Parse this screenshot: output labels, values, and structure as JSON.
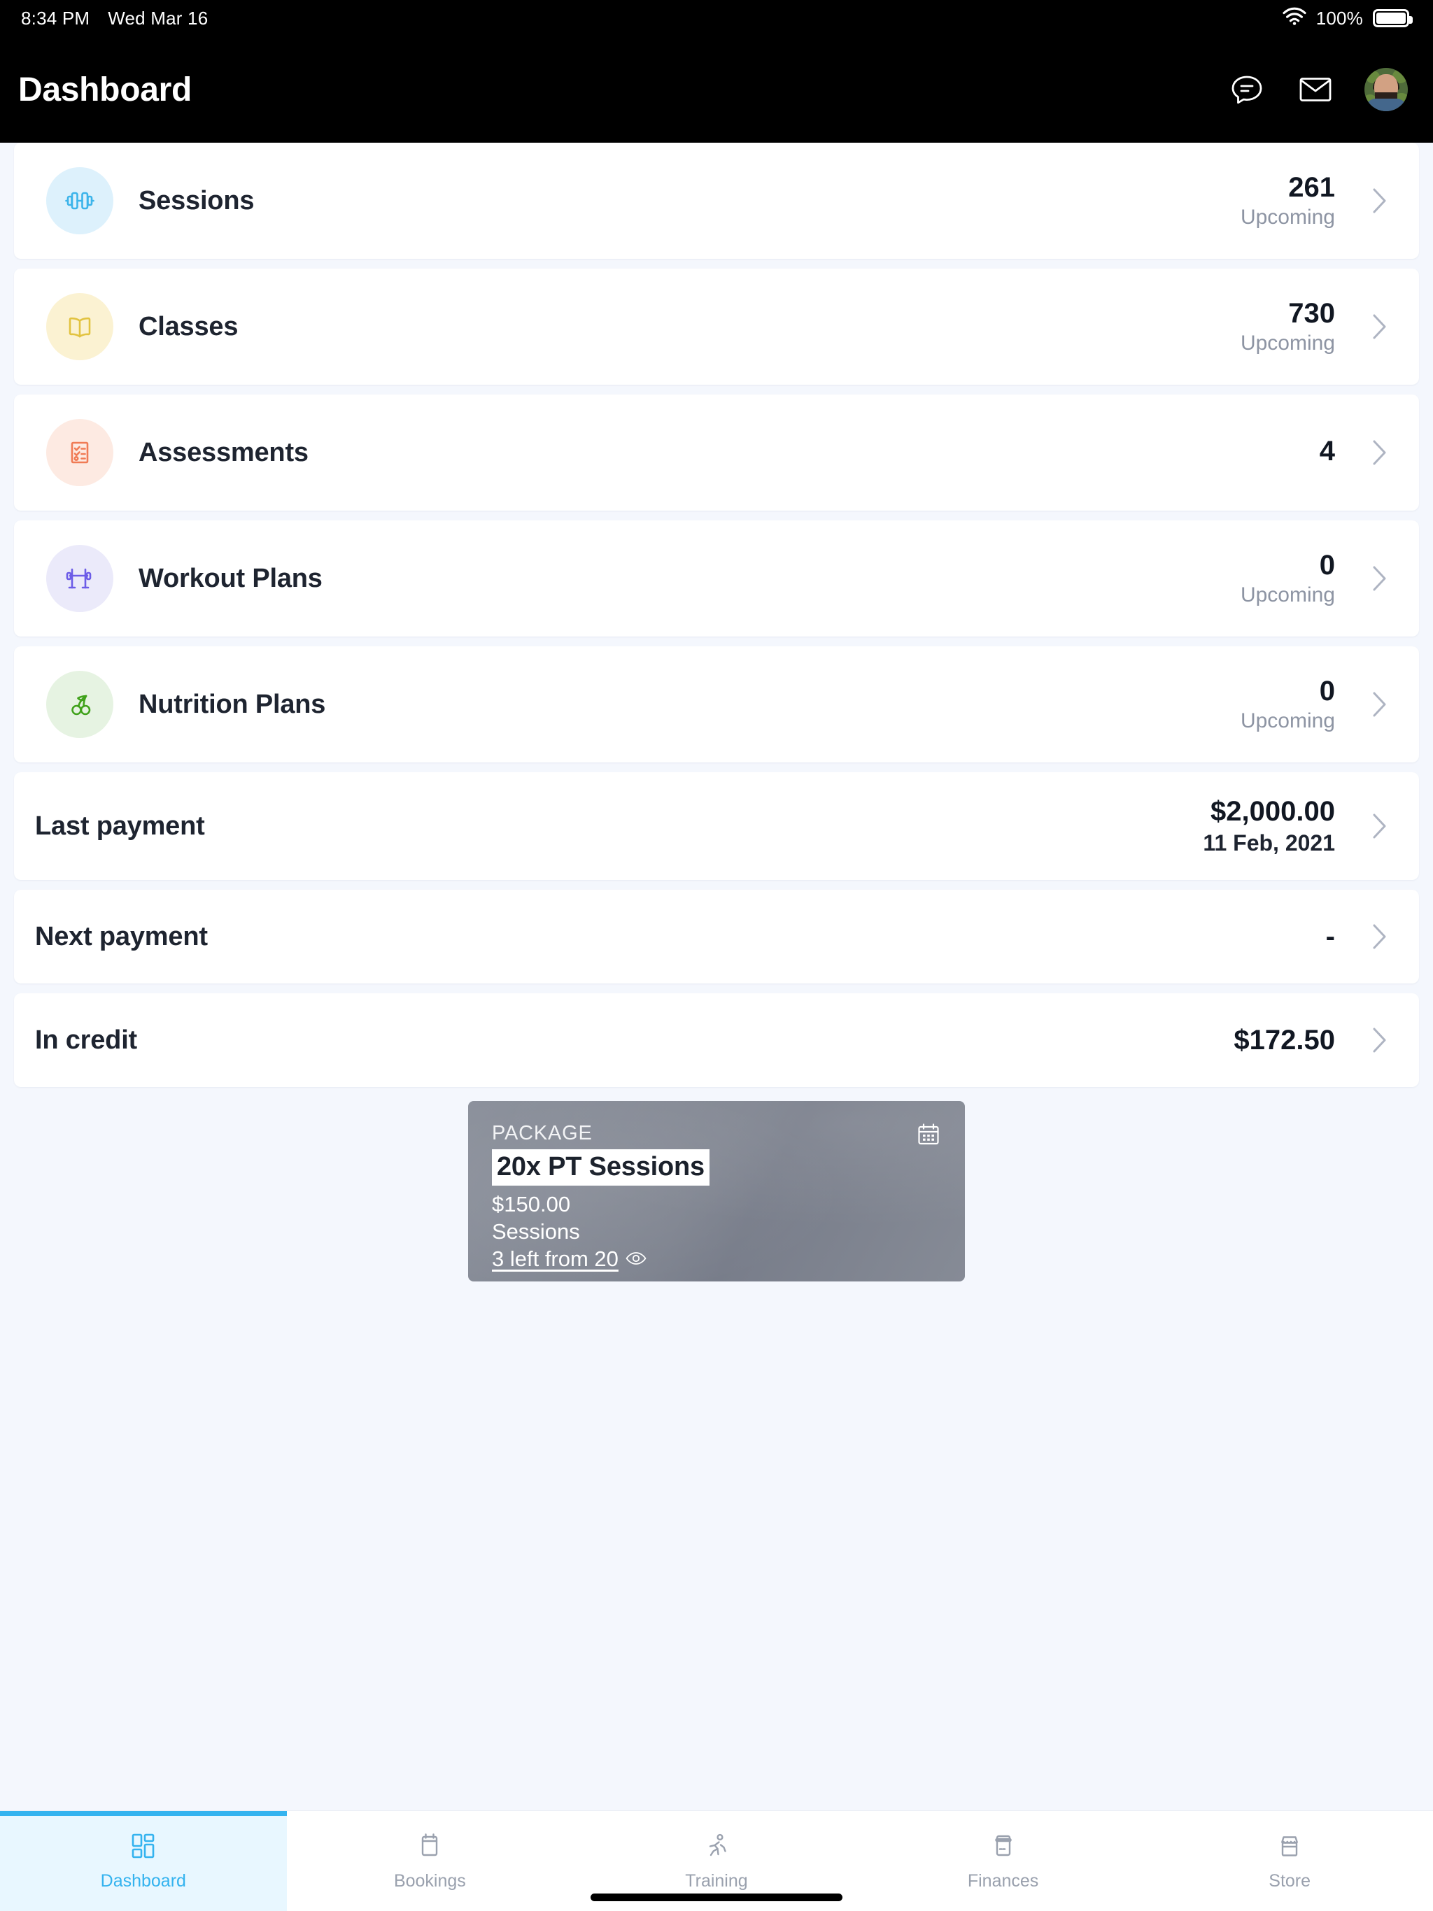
{
  "status_bar": {
    "time": "8:34 PM",
    "date": "Wed Mar 16",
    "battery_percent": "100%",
    "wifi_icon": "wifi-icon",
    "battery_icon": "battery-full-icon"
  },
  "header": {
    "title": "Dashboard",
    "chat_icon": "chat-bubble-icon",
    "mail_icon": "envelope-icon",
    "avatar_icon": "user-avatar"
  },
  "stats": [
    {
      "label": "Sessions",
      "value": "261",
      "sub": "Upcoming",
      "icon": "dumbbell-icon",
      "bg": "#ddf1fc",
      "fg": "#3cb4ea"
    },
    {
      "label": "Classes",
      "value": "730",
      "sub": "Upcoming",
      "icon": "open-book-icon",
      "bg": "#fbf2d2",
      "fg": "#e2c340"
    },
    {
      "label": "Assessments",
      "value": "4",
      "sub": "",
      "icon": "checklist-icon",
      "bg": "#fdeae2",
      "fg": "#f07b55"
    },
    {
      "label": "Workout Plans",
      "value": "0",
      "sub": "Upcoming",
      "icon": "barbell-rack-icon",
      "bg": "#ebeafa",
      "fg": "#6c5ce7"
    },
    {
      "label": "Nutrition Plans",
      "value": "0",
      "sub": "Upcoming",
      "icon": "cherries-icon",
      "bg": "#e6f3e2",
      "fg": "#40a21b"
    }
  ],
  "payments": [
    {
      "label": "Last payment",
      "value": "$2,000.00",
      "sub": "11 Feb, 2021"
    },
    {
      "label": "Next payment",
      "value": "-",
      "sub": ""
    },
    {
      "label": "In credit",
      "value": "$172.50",
      "sub": ""
    }
  ],
  "package_card": {
    "kicker": "PACKAGE",
    "name": "20x PT Sessions",
    "price": "$150.00",
    "type": "Sessions",
    "remaining": "3 left from 20",
    "calendar_icon": "calendar-icon",
    "eye_icon": "eye-icon"
  },
  "tabs": [
    {
      "label": "Dashboard",
      "icon": "grid-dashboard-icon",
      "active": true
    },
    {
      "label": "Bookings",
      "icon": "calendar-bookings-icon",
      "active": false
    },
    {
      "label": "Training",
      "icon": "running-person-icon",
      "active": false
    },
    {
      "label": "Finances",
      "icon": "credit-card-icon",
      "active": false
    },
    {
      "label": "Store",
      "icon": "storefront-icon",
      "active": false
    }
  ],
  "colors": {
    "accent": "#34b3ef",
    "page_bg": "#f4f7fd",
    "card_bg": "#ffffff",
    "text_primary": "#1e2430",
    "text_muted": "#8d94a3"
  }
}
